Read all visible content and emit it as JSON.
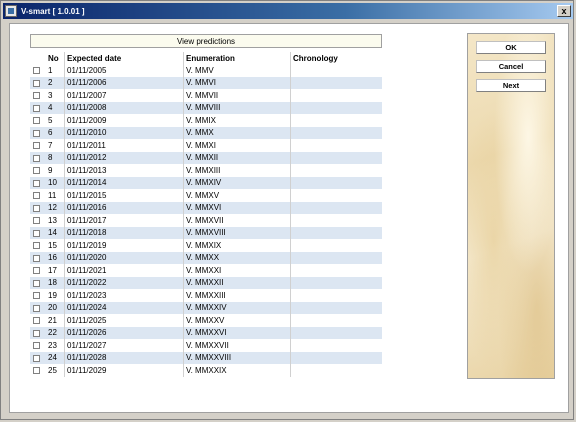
{
  "window": {
    "title": "V-smart [ 1.0.01 ]",
    "close_label": "x"
  },
  "panel": {
    "title": "View predictions"
  },
  "table": {
    "columns": {
      "no": "No",
      "date": "Expected date",
      "enumeration": "Enumeration",
      "chronology": "Chronology"
    },
    "rows": [
      {
        "no": "1",
        "date": "01/11/2005",
        "enum": "V. MMV",
        "chron": ""
      },
      {
        "no": "2",
        "date": "01/11/2006",
        "enum": "V. MMVI",
        "chron": ""
      },
      {
        "no": "3",
        "date": "01/11/2007",
        "enum": "V. MMVII",
        "chron": ""
      },
      {
        "no": "4",
        "date": "01/11/2008",
        "enum": "V. MMVIII",
        "chron": ""
      },
      {
        "no": "5",
        "date": "01/11/2009",
        "enum": "V. MMIX",
        "chron": ""
      },
      {
        "no": "6",
        "date": "01/11/2010",
        "enum": "V. MMX",
        "chron": ""
      },
      {
        "no": "7",
        "date": "01/11/2011",
        "enum": "V. MMXI",
        "chron": ""
      },
      {
        "no": "8",
        "date": "01/11/2012",
        "enum": "V. MMXII",
        "chron": ""
      },
      {
        "no": "9",
        "date": "01/11/2013",
        "enum": "V. MMXIII",
        "chron": ""
      },
      {
        "no": "10",
        "date": "01/11/2014",
        "enum": "V. MMXIV",
        "chron": ""
      },
      {
        "no": "11",
        "date": "01/11/2015",
        "enum": "V. MMXV",
        "chron": ""
      },
      {
        "no": "12",
        "date": "01/11/2016",
        "enum": "V. MMXVI",
        "chron": ""
      },
      {
        "no": "13",
        "date": "01/11/2017",
        "enum": "V. MMXVII",
        "chron": ""
      },
      {
        "no": "14",
        "date": "01/11/2018",
        "enum": "V. MMXVIII",
        "chron": ""
      },
      {
        "no": "15",
        "date": "01/11/2019",
        "enum": "V. MMXIX",
        "chron": ""
      },
      {
        "no": "16",
        "date": "01/11/2020",
        "enum": "V. MMXX",
        "chron": ""
      },
      {
        "no": "17",
        "date": "01/11/2021",
        "enum": "V. MMXXI",
        "chron": ""
      },
      {
        "no": "18",
        "date": "01/11/2022",
        "enum": "V. MMXXII",
        "chron": ""
      },
      {
        "no": "19",
        "date": "01/11/2023",
        "enum": "V. MMXXIII",
        "chron": ""
      },
      {
        "no": "20",
        "date": "01/11/2024",
        "enum": "V. MMXXIV",
        "chron": ""
      },
      {
        "no": "21",
        "date": "01/11/2025",
        "enum": "V. MMXXV",
        "chron": ""
      },
      {
        "no": "22",
        "date": "01/11/2026",
        "enum": "V. MMXXVI",
        "chron": ""
      },
      {
        "no": "23",
        "date": "01/11/2027",
        "enum": "V. MMXXVII",
        "chron": ""
      },
      {
        "no": "24",
        "date": "01/11/2028",
        "enum": "V. MMXXVIII",
        "chron": ""
      },
      {
        "no": "25",
        "date": "01/11/2029",
        "enum": "V. MMXXIX",
        "chron": ""
      }
    ]
  },
  "buttons": {
    "ok": "OK",
    "cancel": "Cancel",
    "next": "Next"
  },
  "colors": {
    "alt_row": "#dce6f2",
    "title_bar": "#0a246a"
  }
}
